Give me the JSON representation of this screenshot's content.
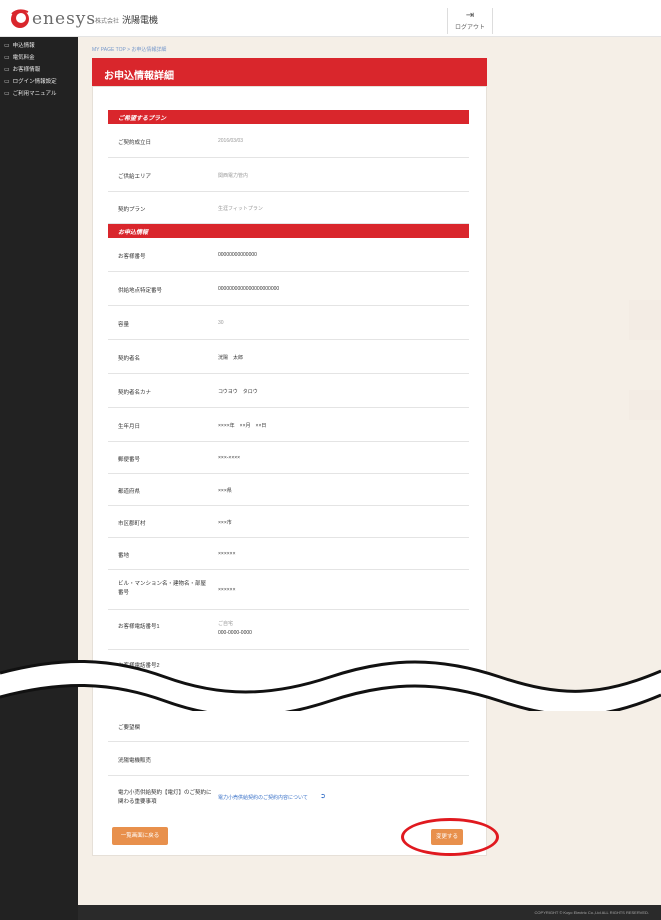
{
  "header": {
    "logo_text": "enesys",
    "company_prefix": "株式会社",
    "company_name": "洸陽電機",
    "logout_label": "ログアウト",
    "logout_icon": "exit-icon"
  },
  "sidebar": {
    "items": [
      {
        "label": "申込情報",
        "icon": "doc-icon"
      },
      {
        "label": "電気料金",
        "icon": "doc-icon"
      },
      {
        "label": "お客様情報",
        "icon": "doc-icon"
      },
      {
        "label": "ログイン情報設定",
        "icon": "doc-icon"
      },
      {
        "label": "ご利用マニュアル",
        "icon": "doc-icon"
      }
    ]
  },
  "breadcrumb": "MY PAGE TOP > お申込情報詳細",
  "page_title": "お申込情報詳細",
  "sections": {
    "plan_title": "ご希望するプラン",
    "app_title": "お申込情報"
  },
  "plan_rows": [
    {
      "label": "ご契約成立日",
      "value": "2016/03/03",
      "style": "gray"
    },
    {
      "label": "ご供給エリア",
      "value": "関西電力管内",
      "style": "gray"
    },
    {
      "label": "契約プラン",
      "value": "生涯フィットプラン",
      "style": "gray"
    }
  ],
  "app_rows": [
    {
      "label": "お客様番号",
      "value": "00000000000000",
      "style": ""
    },
    {
      "label": "供給地点特定番号",
      "value": "0000000000000000000000",
      "style": ""
    },
    {
      "label": "容量",
      "value": "30",
      "style": "gray"
    },
    {
      "label": "契約者名",
      "value": "洸陽　太郎",
      "style": ""
    },
    {
      "label": "契約者名カナ",
      "value": "コウヨウ　タロウ",
      "style": ""
    },
    {
      "label": "生年月日",
      "value": "××××年　××月　××日",
      "style": ""
    },
    {
      "label": "郵便番号",
      "value": "×××-××××",
      "style": ""
    },
    {
      "label": "都道府県",
      "value": "×××県",
      "style": ""
    },
    {
      "label": "市区郡町村",
      "value": "×××市",
      "style": ""
    },
    {
      "label": "番地",
      "value": "××××××",
      "style": ""
    },
    {
      "label": "ビル・マンション名・建物名・部屋番号",
      "value": "××××××",
      "style": ""
    },
    {
      "label": "お客様電話番号1",
      "value": "ご自宅",
      "value2": "000-0000-0000",
      "style": "gray"
    },
    {
      "label": "お客様電話番号2",
      "value": "",
      "style": ""
    },
    {
      "label": "ご要望欄",
      "value": "",
      "style": ""
    },
    {
      "label": "洸陽電機販売",
      "value": "",
      "style": ""
    },
    {
      "label": "電力小売供給契約【電灯】のご契約に関わる重要事項",
      "value": "電力小売供給契約のご契約内容について",
      "style": "link"
    }
  ],
  "buttons": {
    "back": "一覧画面に戻る",
    "change": "変更する"
  },
  "footer": "COPYRIGHT © Koyo Electric Co.,Ltd ALL RIGHTS RESERVED."
}
